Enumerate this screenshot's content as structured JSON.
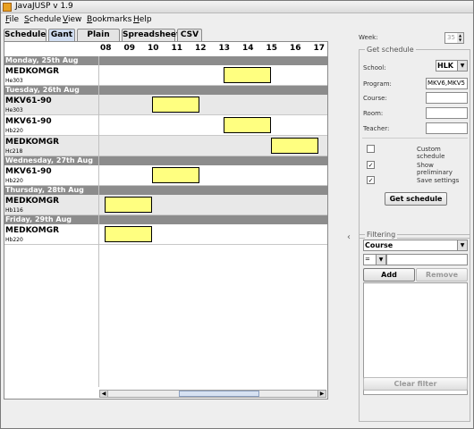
{
  "window": {
    "title": "JavaJUSP v 1.9"
  },
  "menu": [
    {
      "label": "File",
      "underline": "F",
      "rest": "ile"
    },
    {
      "label": "Schedule",
      "underline": "S",
      "rest": "chedule"
    },
    {
      "label": "View",
      "underline": "V",
      "rest": "iew"
    },
    {
      "label": "Bookmarks",
      "underline": "B",
      "rest": "ookmarks"
    },
    {
      "label": "Help",
      "underline": "H",
      "rest": "elp"
    }
  ],
  "tabs": [
    "Schedule",
    "Gant",
    "Plain text",
    "Spreadsheet",
    "CSV"
  ],
  "active_tab": "Gant",
  "gantt": {
    "hours": [
      "08",
      "09",
      "10",
      "11",
      "12",
      "13",
      "14",
      "15",
      "16",
      "17"
    ],
    "days": [
      {
        "header": "Monday, 25th Aug",
        "rows": [
          {
            "course": "MEDKOMGR",
            "room": "He303",
            "start": 13,
            "end": 15,
            "alt": false
          }
        ]
      },
      {
        "header": "Tuesday, 26th Aug",
        "rows": [
          {
            "course": "MKV61-90",
            "room": "He303",
            "start": 10,
            "end": 12,
            "alt": true
          },
          {
            "course": "MKV61-90",
            "room": "Hb220",
            "start": 13,
            "end": 15,
            "alt": false
          },
          {
            "course": "MEDKOMGR",
            "room": "Hc218",
            "start": 15,
            "end": 17,
            "alt": true
          }
        ]
      },
      {
        "header": "Wednesday, 27th Aug",
        "rows": [
          {
            "course": "MKV61-90",
            "room": "Hb220",
            "start": 10,
            "end": 12,
            "alt": false
          }
        ]
      },
      {
        "header": "Thursday, 28th Aug",
        "rows": [
          {
            "course": "MEDKOMGR",
            "room": "Hb116",
            "start": 8,
            "end": 10,
            "alt": true
          }
        ]
      },
      {
        "header": "Friday, 29th Aug",
        "rows": [
          {
            "course": "MEDKOMGR",
            "room": "Hb220",
            "start": 8,
            "end": 10,
            "alt": false
          }
        ]
      }
    ]
  },
  "side": {
    "week_label": "Week:",
    "week_value": "35",
    "get_schedule_title": "Get schedule",
    "school_label": "School:",
    "school_value": "HLK",
    "program_label": "Program:",
    "program_value": "MKV6,MKV5",
    "course_label": "Course:",
    "course_value": "",
    "room_label": "Room:",
    "room_value": "",
    "teacher_label": "Teacher:",
    "teacher_value": "",
    "custom_schedule_label": "Custom schedule",
    "custom_schedule_checked": false,
    "show_preliminary_label": "Show preliminary",
    "show_preliminary_checked": true,
    "save_settings_label": "Save settings",
    "save_settings_checked": true,
    "get_schedule_button": "Get schedule",
    "filtering_title": "Filtering",
    "filter_field_value": "Course",
    "filter_op_value": "=",
    "filter_text": "",
    "add_button": "Add",
    "remove_button": "Remove",
    "clear_filter_button": "Clear filter"
  }
}
